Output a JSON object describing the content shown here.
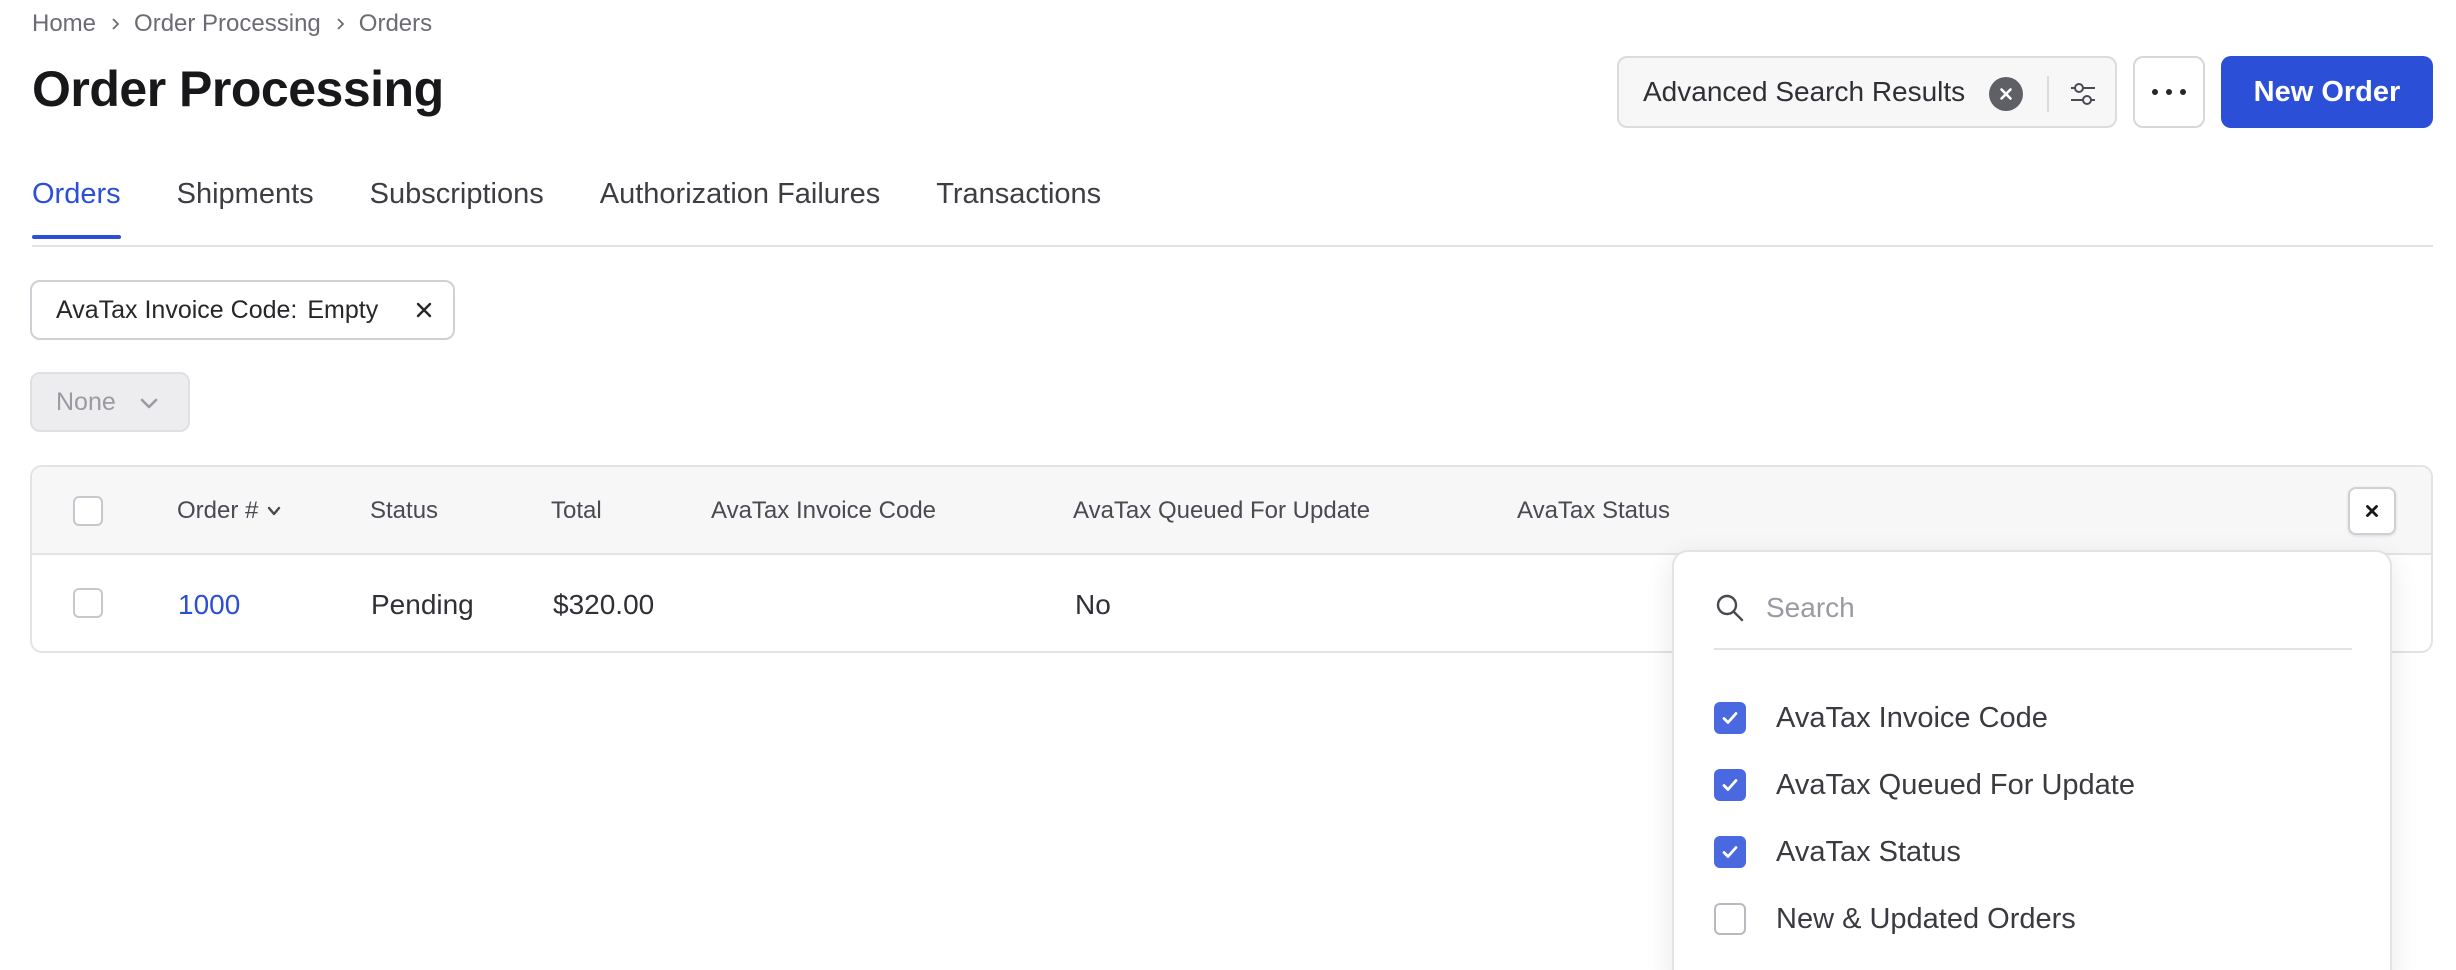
{
  "breadcrumb": {
    "items": [
      "Home",
      "Order Processing",
      "Orders"
    ]
  },
  "page": {
    "title": "Order Processing"
  },
  "header": {
    "search_chip_label": "Advanced Search Results",
    "new_order_label": "New Order"
  },
  "tabs": [
    {
      "label": "Orders",
      "active": true
    },
    {
      "label": "Shipments",
      "active": false
    },
    {
      "label": "Subscriptions",
      "active": false
    },
    {
      "label": "Authorization Failures",
      "active": false
    },
    {
      "label": "Transactions",
      "active": false
    }
  ],
  "filter": {
    "key": "AvaTax Invoice Code:",
    "value": "Empty"
  },
  "view_select": {
    "value": "None"
  },
  "table": {
    "columns": [
      "Order #",
      "Status",
      "Total",
      "AvaTax Invoice Code",
      "AvaTax Queued For Update",
      "AvaTax Status"
    ],
    "rows": [
      {
        "order": "1000",
        "status": "Pending",
        "total": "$320.00",
        "avatax_invoice_code": "",
        "avatax_queued": "No",
        "avatax_status": ""
      }
    ]
  },
  "column_picker": {
    "search_placeholder": "Search",
    "options": [
      {
        "label": "AvaTax Invoice Code",
        "checked": true
      },
      {
        "label": "AvaTax Queued For Update",
        "checked": true
      },
      {
        "label": "AvaTax Status",
        "checked": true
      },
      {
        "label": "New & Updated Orders",
        "checked": false
      }
    ]
  },
  "colors": {
    "accent": "#2b4fd6",
    "checkbox_on": "#4a68e0",
    "border": "#e3e3e7"
  }
}
